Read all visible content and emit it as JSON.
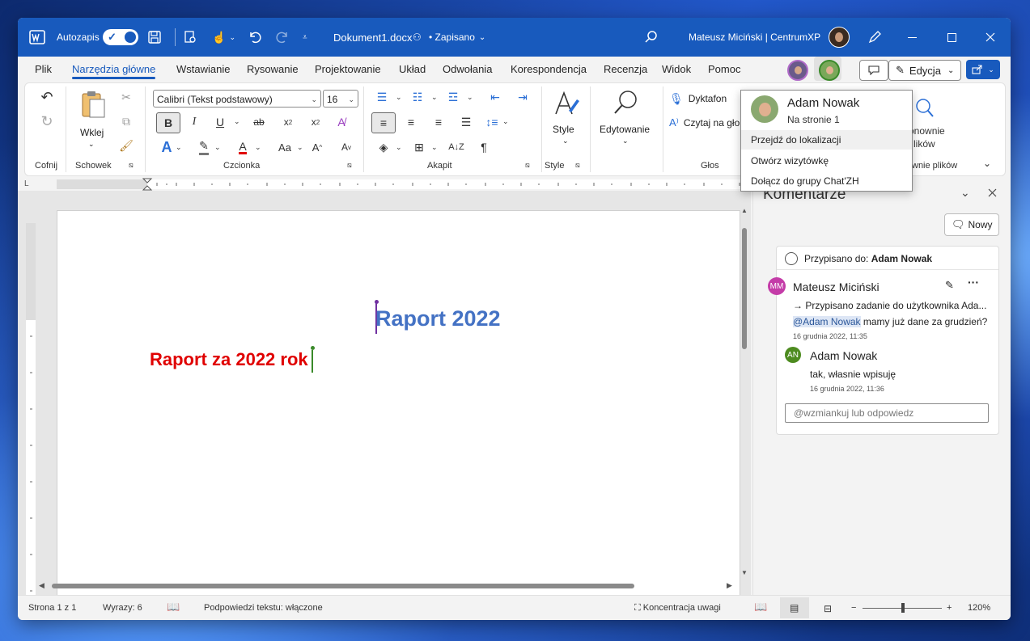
{
  "title_bar": {
    "autosave_label": "Autozapis",
    "doc_name": "Dokument1.docx",
    "save_status": "• Zapisano",
    "user_name": "Mateusz Miciński | CentrumXP"
  },
  "tabs": [
    "Plik",
    "Narzędzia główne",
    "Wstawianie",
    "Rysowanie",
    "Projektowanie",
    "Układ",
    "Odwołania",
    "Korespondencja",
    "Recenzja",
    "Widok",
    "Pomoc"
  ],
  "active_tab": "Narzędzia główne",
  "mode_button": "Edycja",
  "ribbon": {
    "undo_group": "Cofnij",
    "clipboard": {
      "paste": "Wklej",
      "label": "Schowek"
    },
    "font": {
      "name": "Calibri (Tekst podstawowy)",
      "size": "16",
      "label": "Czcionka"
    },
    "paragraph_label": "Akapit",
    "styles": {
      "button": "Style",
      "label": "Style"
    },
    "editing": "Edytowanie",
    "voice": {
      "dictate": "Dyktafon",
      "read_aloud": "Czytaj na gło",
      "label": "Głos"
    },
    "reuse": {
      "line1": "onownie",
      "line2": "lików",
      "label": "wnie plików"
    }
  },
  "document": {
    "heading": "Raport 2022",
    "body_text": "Raport za 2022 rok"
  },
  "comments_pane": {
    "title": "Komentarze",
    "new_button": "Nowy",
    "assigned_label": "Przypisano do:",
    "assigned_name": "Adam Nowak",
    "comment": {
      "author": "Mateusz Miciński",
      "initials": "MM",
      "task_line": "→ Przypisano zadanie do użytkownika Ada...",
      "mention": "@Adam Nowak",
      "text": " mamy już dane za grudzień?",
      "date": "16 grudnia 2022, 11:35"
    },
    "reply": {
      "author": "Adam Nowak",
      "initials": "AN",
      "text": "tak, własnie wpisuję",
      "date": "16 grudnia 2022, 11:36"
    },
    "reply_placeholder": "@wzmiankuj lub odpowiedz"
  },
  "presence_popup": {
    "name": "Adam Nowak",
    "location": "Na stronie 1",
    "items": [
      "Przejdź do lokalizacji",
      "Otwórz wizytówkę",
      "Dołącz do grupy Chat'ZH"
    ]
  },
  "status_bar": {
    "page": "Strona 1 z 1",
    "words": "Wyrazy: 6",
    "predictions": "Podpowiedzi tekstu: włączone",
    "focus": "Koncentracja uwagi",
    "zoom": "120%"
  },
  "colors": {
    "brand_blue": "#185abd",
    "heading_blue": "#4472c4",
    "body_red": "#e00000",
    "mm_avatar": "#c43ca8",
    "an_avatar": "#4d8b1f"
  },
  "icons": [
    "word-icon",
    "save-icon",
    "undo-icon",
    "redo-icon",
    "search-icon",
    "pen-icon",
    "minimize-icon",
    "maximize-icon",
    "close-icon",
    "comment-icon",
    "share-icon",
    "paste-icon",
    "cut-icon",
    "copy-icon",
    "format-painter-icon",
    "styles-icon",
    "find-icon",
    "microphone-icon",
    "read-aloud-icon",
    "collapse-ribbon-icon"
  ]
}
